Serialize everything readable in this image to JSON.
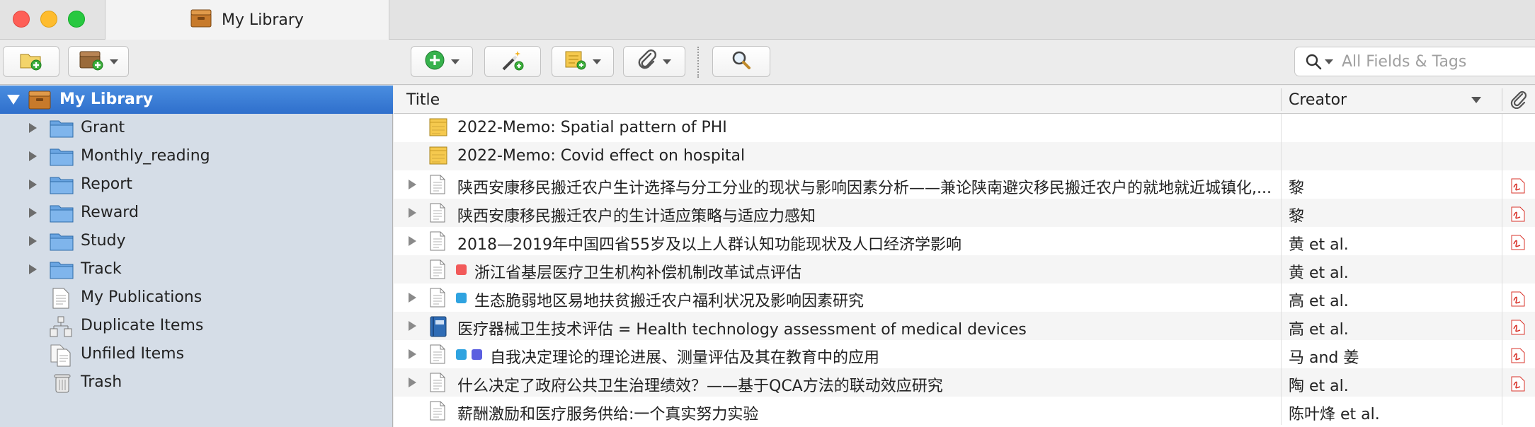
{
  "window": {
    "tab_title": "My Library"
  },
  "search": {
    "placeholder": "All Fields & Tags"
  },
  "sidebar": {
    "library_label": "My Library",
    "folders": [
      "Grant",
      "Monthly_reading",
      "Report",
      "Reward",
      "Study",
      "Track"
    ],
    "specials": [
      {
        "label": "My Publications",
        "icon": "document-icon"
      },
      {
        "label": "Duplicate Items",
        "icon": "duplicate-icon"
      },
      {
        "label": "Unfiled Items",
        "icon": "unfiled-icon"
      },
      {
        "label": "Trash",
        "icon": "trash-icon"
      }
    ]
  },
  "table": {
    "columns": {
      "title": "Title",
      "creator": "Creator"
    },
    "rows": [
      {
        "title": "2022-Memo: Spatial pattern of PHI",
        "creator": "",
        "icon": "note-icon",
        "expandable": false,
        "pdf": false,
        "tags": []
      },
      {
        "title": "2022-Memo: Covid effect on hospital",
        "creator": "",
        "icon": "note-icon",
        "expandable": false,
        "pdf": false,
        "tags": []
      },
      {
        "title": "陕西安康移民搬迁农户生计选择与分工分业的现状与影响因素分析——兼论陕南避灾移民搬迁农户的就地就近城镇化,...",
        "creator": "黎",
        "icon": "document-icon",
        "expandable": true,
        "pdf": true,
        "tags": []
      },
      {
        "title": "陕西安康移民搬迁农户的生计适应策略与适应力感知",
        "creator": "黎",
        "icon": "document-icon",
        "expandable": true,
        "pdf": true,
        "tags": []
      },
      {
        "title": "2018—2019年中国四省55岁及以上人群认知功能现状及人口经济学影响",
        "creator": "黄 et al.",
        "icon": "document-icon",
        "expandable": true,
        "pdf": true,
        "tags": []
      },
      {
        "title": "浙江省基层医疗卫生机构补偿机制改革试点评估",
        "creator": "黄 et al.",
        "icon": "document-icon",
        "expandable": false,
        "pdf": false,
        "tags": [
          "#f25a5a"
        ]
      },
      {
        "title": "生态脆弱地区易地扶贫搬迁农户福利状况及影响因素研究",
        "creator": "高 et al.",
        "icon": "document-icon",
        "expandable": true,
        "pdf": true,
        "tags": [
          "#2fa3e0"
        ]
      },
      {
        "title": "医疗器械卫生技术评估 = Health technology assessment of medical devices",
        "creator": "高 et al.",
        "icon": "book-icon",
        "expandable": true,
        "pdf": true,
        "tags": []
      },
      {
        "title": "自我决定理论的理论进展、测量评估及其在教育中的应用",
        "creator": "马 and 姜",
        "icon": "document-icon",
        "expandable": true,
        "pdf": true,
        "tags": [
          "#2fa3e0",
          "#5b5fe0"
        ]
      },
      {
        "title": "什么决定了政府公共卫生治理绩效？——基于QCA方法的联动效应研究",
        "creator": "陶 et al.",
        "icon": "document-icon",
        "expandable": true,
        "pdf": true,
        "tags": []
      },
      {
        "title": "薪酬激励和医疗服务供给:一个真实努力实验",
        "creator": "陈叶烽 et al.",
        "icon": "document-icon",
        "expandable": false,
        "pdf": false,
        "tags": []
      }
    ]
  },
  "colors": {
    "selection": "#3a7bd5",
    "sidebar_bg": "#d5dde7",
    "folder": "#5f9bd8",
    "note": "#f0c24a",
    "pdf": "#d9342b"
  }
}
